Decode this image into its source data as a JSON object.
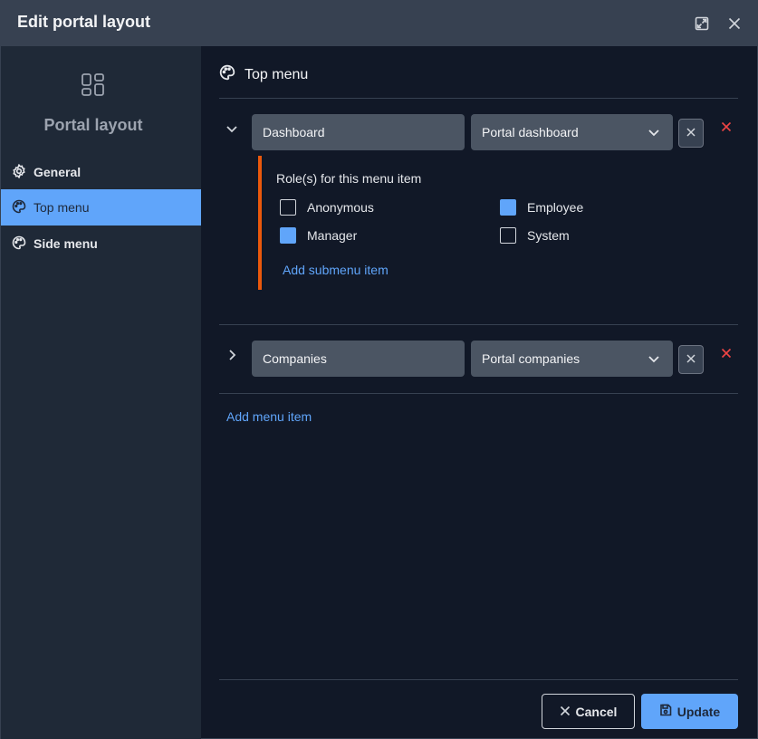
{
  "dialog": {
    "title": "Edit portal layout",
    "expand_icon": "expand-icon",
    "close_icon": "close-icon"
  },
  "sidebar": {
    "heading": "Portal layout",
    "logo_icon": "layout-grid-icon",
    "items": [
      {
        "label": "General",
        "icon": "gear-icon",
        "active": false
      },
      {
        "label": "Top menu",
        "icon": "palette-icon",
        "active": true
      },
      {
        "label": "Side menu",
        "icon": "palette-icon",
        "active": false
      }
    ]
  },
  "main": {
    "section_title": "Top menu",
    "menu_items": [
      {
        "expanded": true,
        "name": "Dashboard",
        "page": "Portal dashboard",
        "roles_label": "Role(s) for this menu item",
        "roles": [
          {
            "label": "Anonymous",
            "checked": false
          },
          {
            "label": "Employee",
            "checked": true
          },
          {
            "label": "Manager",
            "checked": true
          },
          {
            "label": "System",
            "checked": false
          }
        ],
        "add_submenu": "Add submenu item"
      },
      {
        "expanded": false,
        "name": "Companies",
        "page": "Portal companies"
      }
    ],
    "add_menu_item": "Add menu item"
  },
  "footer": {
    "cancel_label": "Cancel",
    "update_label": "Update"
  },
  "colors": {
    "accent": "#60a5fa",
    "danger": "#ef4444",
    "role_bar": "#ea580c",
    "background": "#111827",
    "sidebar": "#1f2937",
    "titlebar": "#374151"
  }
}
